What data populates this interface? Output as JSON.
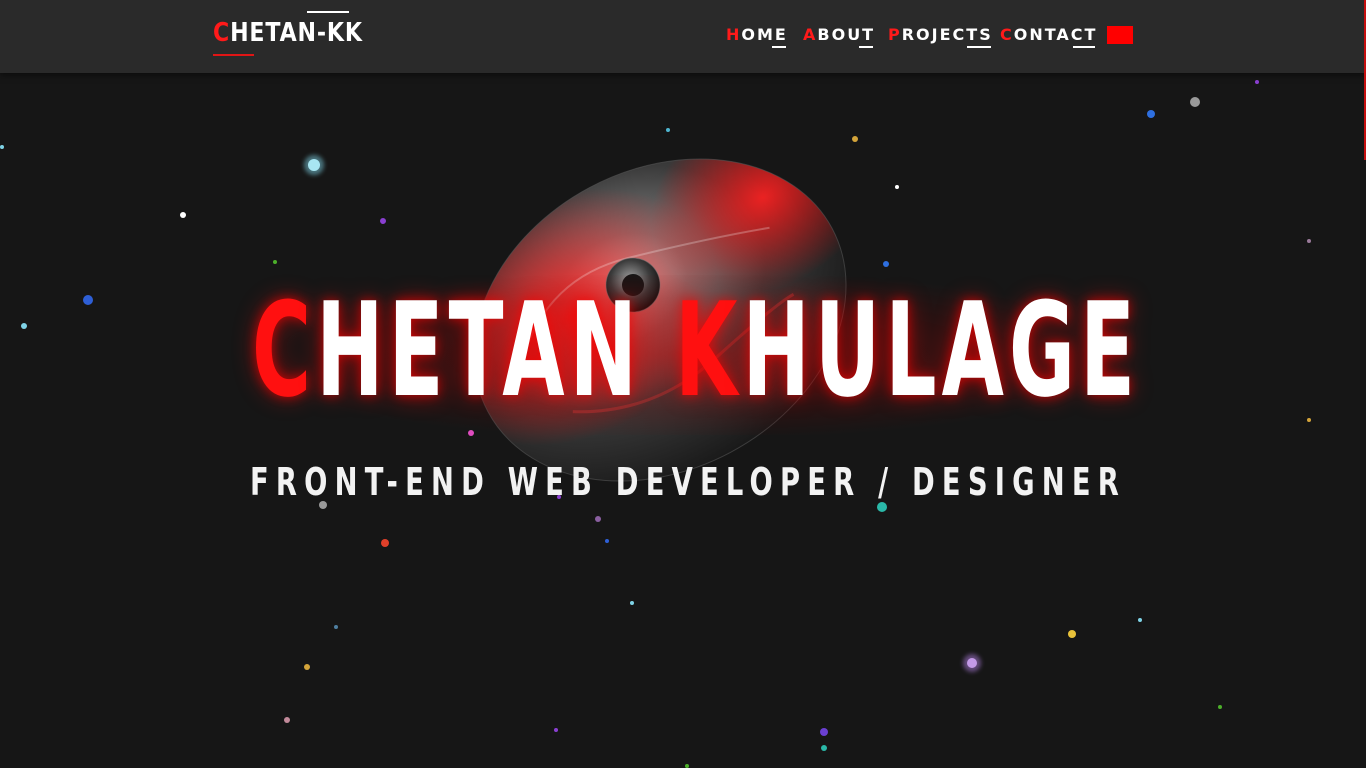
{
  "nav": {
    "logo": {
      "first_letter": "C",
      "rest": "HETAN-KK"
    },
    "items": [
      {
        "first": "H",
        "rest": "OME"
      },
      {
        "first": "A",
        "rest": "BOUT"
      },
      {
        "first": "P",
        "rest": "ROJECTS"
      },
      {
        "first": "C",
        "rest": "ONTACT"
      }
    ],
    "flag_color": "#ff0000"
  },
  "hero": {
    "title_parts": [
      {
        "text": "C",
        "accent": true
      },
      {
        "text": "HETAN ",
        "accent": false
      },
      {
        "text": "K",
        "accent": true
      },
      {
        "text": "HULAGE",
        "accent": false
      }
    ],
    "subtitle": "FRONT-END WEB DEVELOPER / DESIGNER"
  },
  "colors": {
    "accent": "#ff1a1a",
    "navbar": "#2a2a2a",
    "background": "#161616"
  },
  "decor": {
    "background_particles": "colored-star-particles",
    "centerpiece": "metallic-torus-3d-object"
  }
}
